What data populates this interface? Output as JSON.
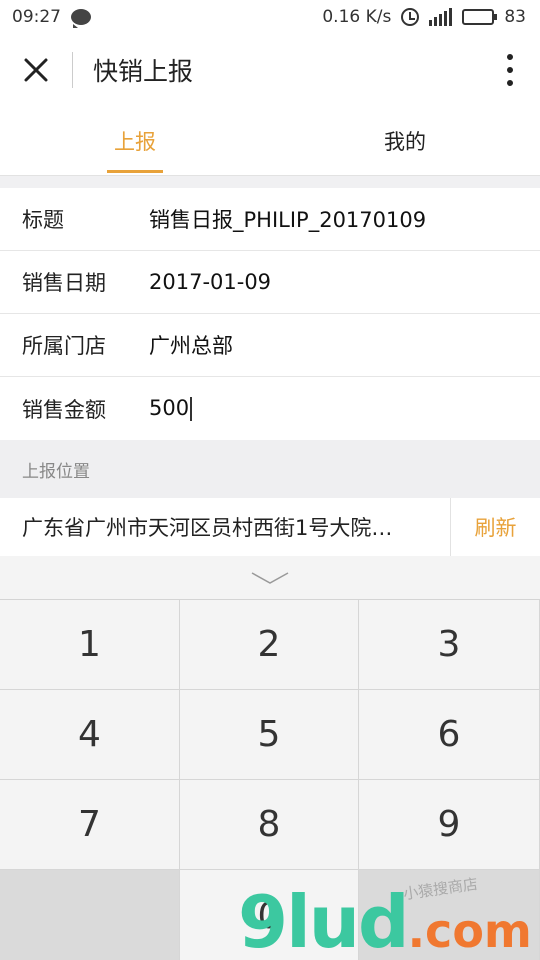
{
  "status": {
    "time": "09:27",
    "speed": "0.16 K/s",
    "network": "4G",
    "battery": "83",
    "battery_level": 0.83
  },
  "titlebar": {
    "title": "快销上报"
  },
  "tabs": [
    {
      "label": "上报",
      "active": true
    },
    {
      "label": "我的",
      "active": false
    }
  ],
  "form": {
    "rows": [
      {
        "label": "标题",
        "value": "销售日报_PHILIP_20170109"
      },
      {
        "label": "销售日期",
        "value": "2017-01-09"
      },
      {
        "label": "所属门店",
        "value": "广州总部"
      },
      {
        "label": "销售金额",
        "value": "500"
      }
    ]
  },
  "location": {
    "section_label": "上报位置",
    "address": "广东省广州市天河区员村西街1号大院…",
    "refresh_label": "刷新"
  },
  "keyboard": {
    "keys": [
      "1",
      "2",
      "3",
      "4",
      "5",
      "6",
      "7",
      "8",
      "9",
      "",
      "0",
      ""
    ]
  },
  "watermark": {
    "main": "9lud",
    "suffix": ".com",
    "sub": "小猿搜商店"
  },
  "colors": {
    "accent": "#e8a23a",
    "watermark_green": "#3cc8a0",
    "watermark_orange": "#f07830"
  }
}
